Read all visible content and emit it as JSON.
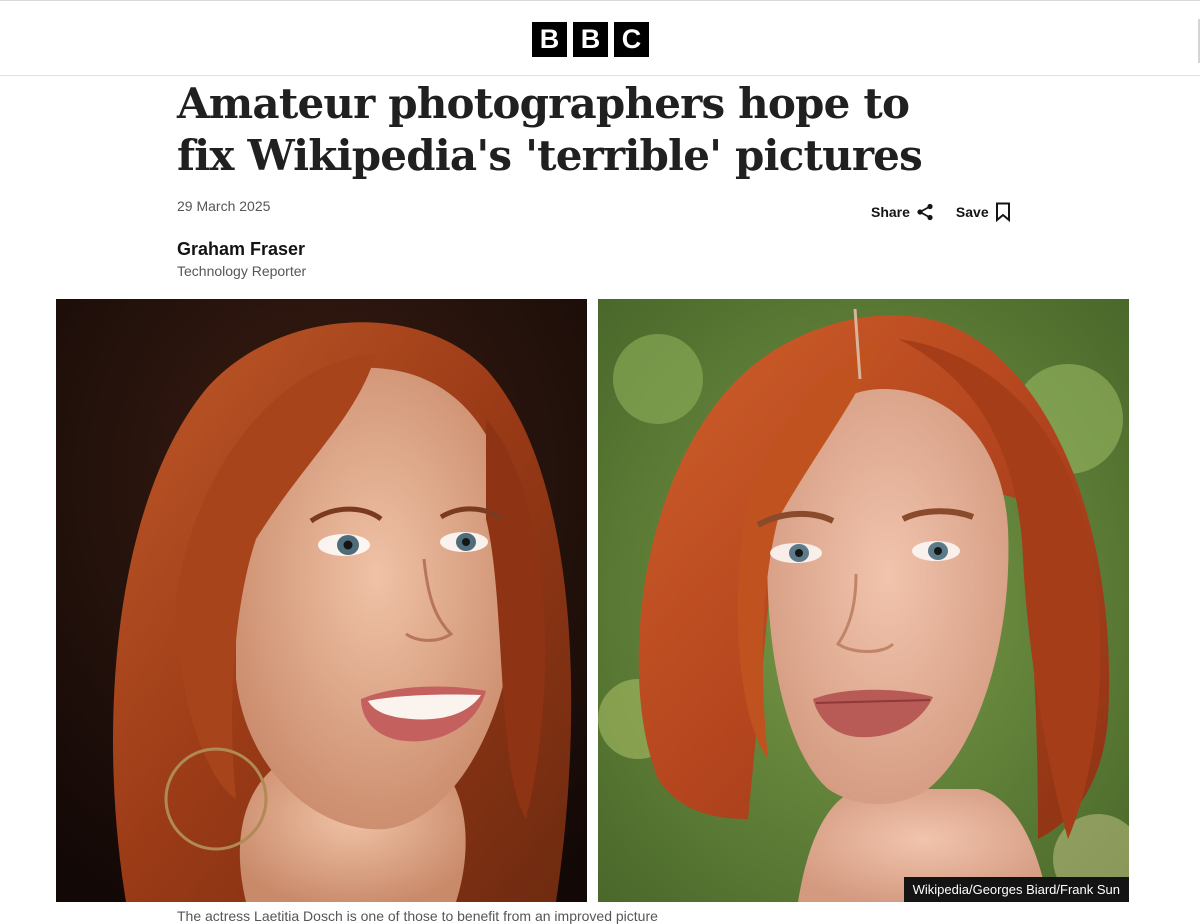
{
  "header": {
    "logo_letters": [
      "B",
      "B",
      "C"
    ]
  },
  "article": {
    "headline": "Amateur photographers hope to fix Wikipedia's 'terrible' pictures",
    "date": "29 March 2025",
    "share_label": "Share",
    "save_label": "Save",
    "author_name": "Graham Fraser",
    "author_role": "Technology Reporter",
    "image_credit": "Wikipedia/Georges Biard/Frank Sun",
    "caption": "The actress Laetitia Dosch is one of those to benefit from an improved picture"
  },
  "colors": {
    "hair": "#b4451e",
    "skin": "#e9b49a",
    "left_background": "#1a0f0c",
    "right_background": "#5e7d3a"
  },
  "icons": [
    "share-icon",
    "bookmark-icon"
  ]
}
